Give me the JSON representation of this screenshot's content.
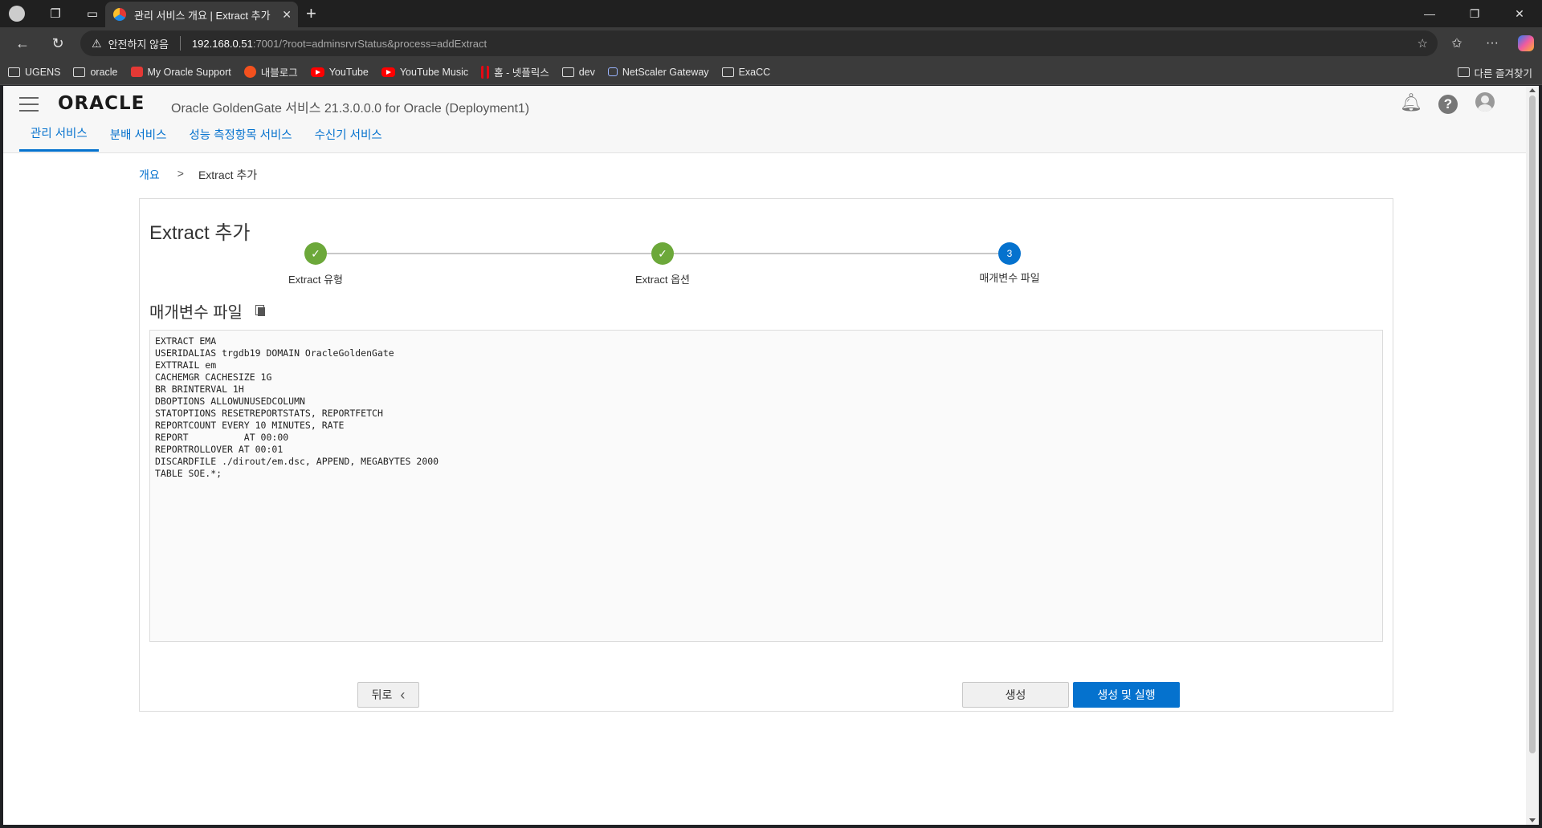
{
  "browser": {
    "tab_title": "관리 서비스 개요 | Extract 추가",
    "security_label": "안전하지 않음",
    "url_host": "192.168.0.51",
    "url_path": ":7001/?root=adminsrvrStatus&process=addExtract",
    "bookmarks": [
      {
        "label": "UGENS",
        "icon": "folder-icon"
      },
      {
        "label": "oracle",
        "icon": "folder-icon"
      },
      {
        "label": "My Oracle Support",
        "icon": "oracle-icon"
      },
      {
        "label": "내블로그",
        "icon": "tistory-icon"
      },
      {
        "label": "YouTube",
        "icon": "youtube-icon"
      },
      {
        "label": "YouTube Music",
        "icon": "youtube-icon"
      },
      {
        "label": "홈 - 넷플릭스",
        "icon": "netflix-icon"
      },
      {
        "label": "dev",
        "icon": "folder-icon"
      },
      {
        "label": "NetScaler Gateway",
        "icon": "lock-icon"
      },
      {
        "label": "ExaCC",
        "icon": "folder-icon"
      }
    ],
    "other_bookmarks": "다른 즐겨찾기"
  },
  "app": {
    "logo": "ORACLE",
    "title": "Oracle GoldenGate 서비스 21.3.0.0.0 for Oracle (Deployment1)",
    "tabs": [
      {
        "label": "관리 서비스",
        "active": true
      },
      {
        "label": "분배 서비스",
        "active": false
      },
      {
        "label": "성능 측정항목 서비스",
        "active": false
      },
      {
        "label": "수신기 서비스",
        "active": false
      }
    ]
  },
  "breadcrumb": {
    "home": "개요",
    "separator": ">",
    "current": "Extract 추가"
  },
  "wizard": {
    "title": "Extract 추가",
    "steps": [
      {
        "label": "Extract 유형",
        "status": "done"
      },
      {
        "label": "Extract 옵션",
        "status": "done"
      },
      {
        "label": "매개변수 파일",
        "status": "current",
        "number": "3"
      }
    ],
    "section_title": "매개변수 파일",
    "param_file": "EXTRACT EMA\nUSERIDALIAS trgdb19 DOMAIN OracleGoldenGate\nEXTTRAIL em\nCACHEMGR CACHESIZE 1G\nBR BRINTERVAL 1H\nDBOPTIONS ALLOWUNUSEDCOLUMN\nSTATOPTIONS RESETREPORTSTATS, REPORTFETCH\nREPORTCOUNT EVERY 10 MINUTES, RATE\nREPORT          AT 00:00\nREPORTROLLOVER AT 00:01\nDISCARDFILE ./dirout/em.dsc, APPEND, MEGABYTES 2000\nTABLE SOE.*;",
    "buttons": {
      "back": "뒤로",
      "create": "생성",
      "create_run": "생성 및 실행"
    }
  },
  "colors": {
    "accent": "#0572ce",
    "step_done": "#6ca83a"
  }
}
